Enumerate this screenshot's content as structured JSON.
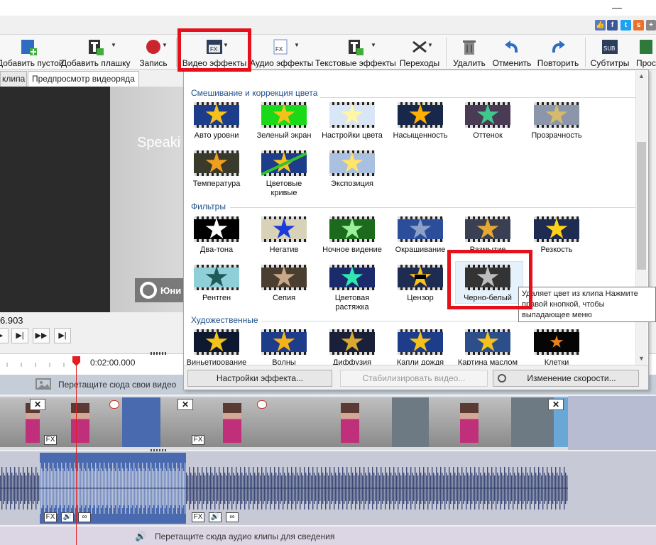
{
  "toolbar": {
    "add_blank": "Добавить пустой",
    "add_plate": "Добавить плашку",
    "record": "Запись",
    "video_effects": "Видео эффекты",
    "audio_effects": "Аудио эффекты",
    "text_effects": "Текстовые эффекты",
    "transitions": "Переходы",
    "delete": "Удалить",
    "undo": "Отменить",
    "redo": "Повторить",
    "subtitles": "Субтитры",
    "more": "Просм"
  },
  "preview": {
    "tab_clip": "клипа",
    "tab_sequence": "Предпросмотр видеоряда",
    "video_text": "Speaki",
    "logo_text": "Юни",
    "timecode": "6.903"
  },
  "timeline": {
    "ruler_time": "0:02:00.000",
    "drop_video": "Перетащите сюда свои видео",
    "drop_audio": "Перетащите сюда аудио клипы для сведения",
    "fx": "FX"
  },
  "panel": {
    "sections": {
      "color": "Смешивание и коррекция цвета",
      "filters": "Фильтры",
      "artistic": "Художественные"
    },
    "color_effects": [
      {
        "label": "Авто уровни"
      },
      {
        "label": "Зеленый экран"
      },
      {
        "label": "Настройки цвета"
      },
      {
        "label": "Насыщенность"
      },
      {
        "label": "Оттенок"
      },
      {
        "label": "Прозрачность"
      },
      {
        "label": "Температура"
      },
      {
        "label": "Цветовые кривые"
      },
      {
        "label": "Экспозиция"
      }
    ],
    "filter_effects": [
      {
        "label": "Два-тона"
      },
      {
        "label": "Негатив"
      },
      {
        "label": "Ночное видение"
      },
      {
        "label": "Окрашивание"
      },
      {
        "label": "Размытие"
      },
      {
        "label": "Резкость"
      },
      {
        "label": "Рентген"
      },
      {
        "label": "Сепия"
      },
      {
        "label": "Цветовая растяжка"
      },
      {
        "label": "Цензор"
      },
      {
        "label": "Черно-белый"
      }
    ],
    "artistic_effects": [
      {
        "label": "Виньетирование"
      },
      {
        "label": "Волны"
      },
      {
        "label": "Диффузия"
      },
      {
        "label": "Капли дождя"
      },
      {
        "label": "Картина маслом"
      },
      {
        "label": "Клетки"
      }
    ],
    "buttons": {
      "settings": "Настройки эффекта...",
      "stabilize": "Стабилизировать видео...",
      "speed": "Изменение скорости..."
    },
    "tooltip": "Удаляет цвет из клипа Нажмите правой кнопкой, чтобы выпадающее меню"
  },
  "colors": {
    "highlight": "#e5101a",
    "section_text": "#1e4f8a",
    "audio_wave": "#3c4a78",
    "clip_selected": "#4a6ab0"
  }
}
